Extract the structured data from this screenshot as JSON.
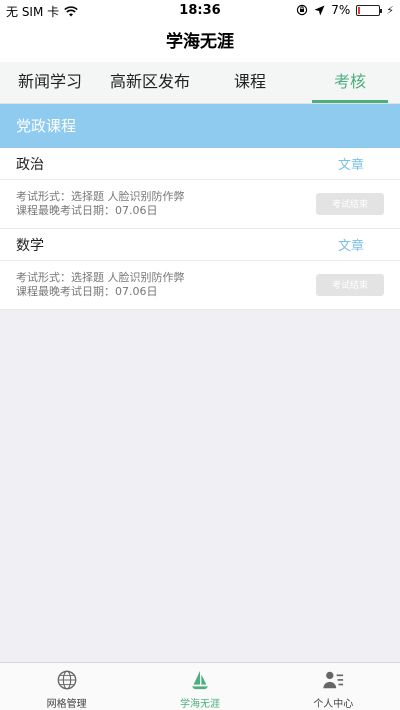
{
  "status_bar": {
    "carrier": "无 SIM 卡",
    "time": "18:36",
    "battery": "7%",
    "battery_level": 0.07,
    "battery_color": "#e53935"
  },
  "nav": {
    "title": "学海无涯"
  },
  "tabs": [
    {
      "label": "新闻学习",
      "active": false
    },
    {
      "label": "高新区发布",
      "active": false
    },
    {
      "label": "课程",
      "active": false
    },
    {
      "label": "考核",
      "active": true
    }
  ],
  "section": {
    "title": "党政课程"
  },
  "courses": [
    {
      "name": "政治",
      "link": "文章",
      "exam_format": "考试形式：选择题 人脸识别防作弊",
      "deadline": "课程最晚考试日期：07.06日",
      "button": "考试结束"
    },
    {
      "name": "数学",
      "link": "文章",
      "exam_format": "考试形式：选择题 人脸识别防作弊",
      "deadline": "课程最晚考试日期：07.06日",
      "button": "考试结束"
    }
  ],
  "tabbar": [
    {
      "label": "网格管理",
      "icon": "grid-globe-icon",
      "active": false
    },
    {
      "label": "学海无涯",
      "icon": "sailboat-icon",
      "active": true
    },
    {
      "label": "个人中心",
      "icon": "user-list-icon",
      "active": false
    }
  ],
  "colors": {
    "accent": "#4caf7d",
    "section_header": "#8ecbef",
    "link": "#7bc0e8",
    "disabled_button": "#e3e3e3"
  }
}
